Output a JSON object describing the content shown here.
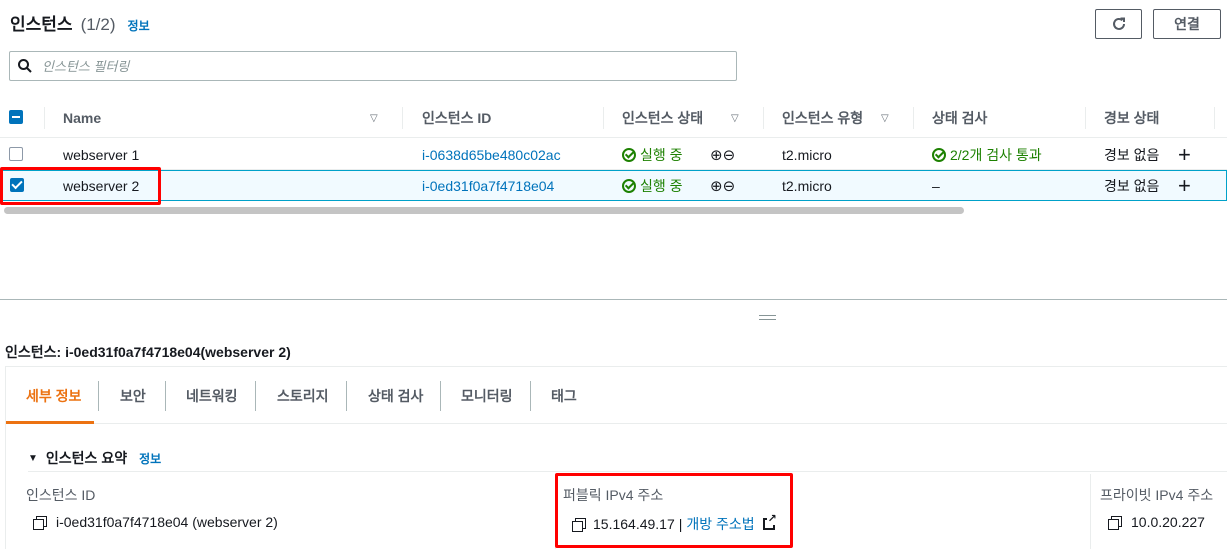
{
  "header": {
    "title": "인스턴스",
    "count": "(1/2)",
    "info": "정보",
    "connect_label": "연결",
    "refresh_icon": "refresh-icon"
  },
  "filter": {
    "placeholder": "인스턴스 필터링"
  },
  "table": {
    "columns": [
      "Name",
      "인스턴스 ID",
      "인스턴스 상태",
      "인스턴스 유형",
      "상태 검사",
      "경보 상태"
    ],
    "rows": [
      {
        "name": "webserver 1",
        "id": "i-0638d65be480c02ac",
        "state": "실행 중",
        "type": "t2.micro",
        "check": "2/2개 검사 통과",
        "alarm": "경보 없음",
        "selected": false
      },
      {
        "name": "webserver 2",
        "id": "i-0ed31f0a7f4718e04",
        "state": "실행 중",
        "type": "t2.micro",
        "check": "–",
        "alarm": "경보 없음",
        "selected": true
      }
    ]
  },
  "detail": {
    "title": "인스턴스: i-0ed31f0a7f4718e04(webserver 2)",
    "tabs": [
      "세부 정보",
      "보안",
      "네트워킹",
      "스토리지",
      "상태 검사",
      "모니터링",
      "태그"
    ],
    "active_tab": "세부 정보",
    "summary_title": "인스턴스 요약",
    "summary_info": "정보",
    "fields": {
      "instance_id_label": "인스턴스 ID",
      "instance_id_value": "i-0ed31f0a7f4718e04 (webserver 2)",
      "public_ip_label": "퍼블릭 IPv4 주소",
      "public_ip_value": "15.164.49.17",
      "public_ip_sep": "|",
      "open_address": "개방 주소법",
      "private_ip_label": "프라이빗 IPv4 주소",
      "private_ip_value": "10.0.20.227"
    }
  },
  "colors": {
    "accent": "#ec7211",
    "link": "#0073bb",
    "success": "#1d8102",
    "highlight": "#ff0000"
  }
}
